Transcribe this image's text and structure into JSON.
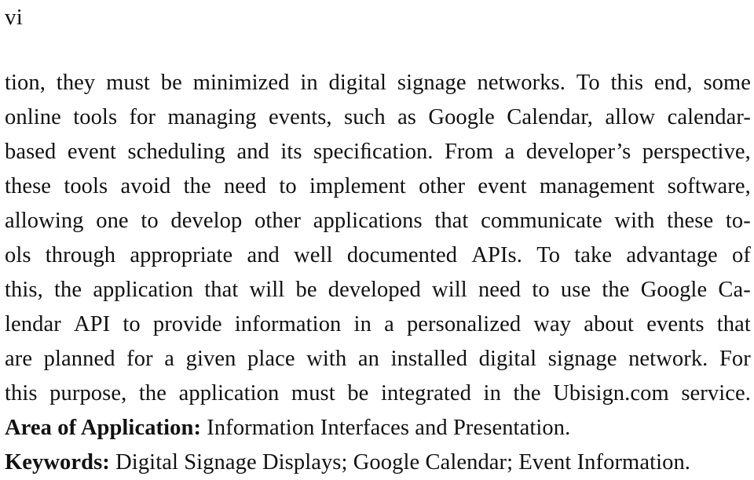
{
  "document": {
    "type": "thesis-abstract-page",
    "page_number": "vi",
    "background_color": "#ffffff",
    "text_color": "#111111",
    "alignment": "justified"
  },
  "lines": [
    {
      "id": "line-1",
      "text": "tion, they must be minimized in digital signage networks. To this end, some",
      "words": [
        "tion,",
        "they",
        "must",
        "be",
        "minimized",
        "in",
        "digital",
        "signage",
        "networks.",
        "To",
        "this",
        "end,",
        "some"
      ],
      "justified": true
    },
    {
      "id": "line-2",
      "text": "online tools for managing events, such as Google Calendar, allow calendar-",
      "words": [
        "online",
        "tools",
        "for",
        "managing",
        "events,",
        "such",
        "as",
        "Google",
        "Calendar,",
        "allow",
        "calendar-"
      ],
      "justified": true
    },
    {
      "id": "line-3",
      "text": "based event scheduling and its specification. From a developer’s perspective,",
      "words": [
        "based",
        "event",
        "scheduling",
        "and",
        "its",
        "speciﬁcation.",
        "From",
        "a",
        "developer’s",
        "perspective,"
      ],
      "justified": true
    },
    {
      "id": "line-4",
      "text": "these tools avoid the need to implement other event management software,",
      "words": [
        "these",
        "tools",
        "avoid",
        "the",
        "need",
        "to",
        "implement",
        "other",
        "event",
        "management",
        "software,"
      ],
      "justified": true
    },
    {
      "id": "line-5",
      "text": "allowing one to develop other applications that communicate with these to-",
      "words": [
        "allowing",
        "one",
        "to",
        "develop",
        "other",
        "applications",
        "that",
        "communicate",
        "with",
        "these",
        "to-"
      ],
      "justified": true
    },
    {
      "id": "line-6",
      "text": "ols through appropriate and well documented APIs. To take advantage of",
      "words": [
        "ols",
        "through",
        "appropriate",
        "and",
        "well",
        "documented",
        "APIs.",
        "To",
        "take",
        "advantage",
        "of"
      ],
      "justified": true
    },
    {
      "id": "line-7",
      "text": "this, the application that will be developed will need to use the Google Ca-",
      "words": [
        "this,",
        "the",
        "application",
        "that",
        "will",
        "be",
        "developed",
        "will",
        "need",
        "to",
        "use",
        "the",
        "Google",
        "Ca-"
      ],
      "justified": true
    },
    {
      "id": "line-8",
      "text": "lendar API to provide information in a personalized way about events that",
      "words": [
        "lendar",
        "API",
        "to",
        "provide",
        "information",
        "in",
        "a",
        "personalized",
        "way",
        "about",
        "events",
        "that"
      ],
      "justified": true
    },
    {
      "id": "line-9",
      "text": "are planned for a given place with an installed digital signage network. For",
      "words": [
        "are",
        "planned",
        "for",
        "a",
        "given",
        "place",
        "with",
        "an",
        "installed",
        "digital",
        "signage",
        "network.",
        "For"
      ],
      "justified": true
    },
    {
      "id": "line-10",
      "text": "this purpose, the application must be integrated in the Ubisign.com service.",
      "words": [
        "this",
        "purpose,",
        "the",
        "application",
        "must",
        "be",
        "integrated",
        "in",
        "the",
        "Ubisign.com",
        "service."
      ],
      "justified": true
    }
  ],
  "area_of_application": {
    "label": "Area of Application:",
    "value": "Information Interfaces and Presentation."
  },
  "keywords": {
    "label": "Keywords:",
    "value": "Digital Signage Displays; Google Calendar; Event Information."
  }
}
